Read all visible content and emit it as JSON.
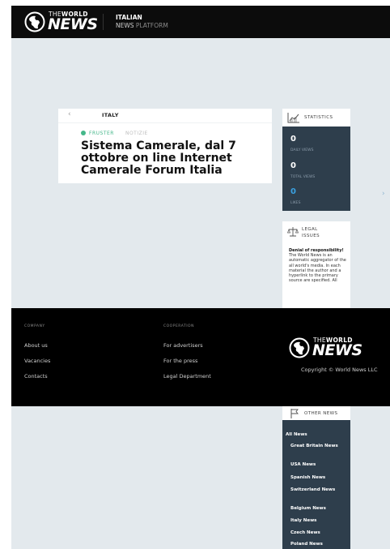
{
  "header": {
    "logo_the": "THE",
    "logo_world": "WORLD",
    "logo_news": "NEWS",
    "title_line1": "ITALIAN",
    "title_line2_a": "NEWS",
    "title_line2_b": "PLATFORM"
  },
  "article": {
    "back_label": "‹",
    "country": "ITALY",
    "tag_primary": "FRUSTER",
    "tag_secondary": "NOTIZIE",
    "headline": "Sistema Camerale, dal 7 ottobre on line Internet Camerale Forum Italia"
  },
  "statistics": {
    "title": "STATISTICS",
    "items": [
      {
        "value": "0",
        "label": "DAILY VIEWS"
      },
      {
        "value": "0",
        "label": "TOTAL VIEWS"
      },
      {
        "value": "0",
        "label": "LIKES"
      }
    ]
  },
  "legal": {
    "title_line1": "LEGAL",
    "title_line2": "ISSUES",
    "bold_text": "Denial of responsibility!",
    "text": " The World News is an automatic aggregator of the all world's media. In each material the author and a hyperlink to the primary source are specified. All"
  },
  "footer": {
    "col1_heading": "COMPANY",
    "col1_links": [
      "About us",
      "Vacancies",
      "Contacts"
    ],
    "col2_heading": "COOPERATION",
    "col2_links": [
      "For advertisers",
      "For the press",
      "Legal Department"
    ],
    "copyright": "Copyright © World News LLC"
  },
  "other_news": {
    "title": "OTHER NEWS",
    "links": [
      "All News",
      "Great Britain News",
      "USA News",
      "Spanish News",
      "Switzerland News",
      "Belgium News",
      "Italy News",
      "Czech News",
      "Poland News"
    ]
  },
  "colors": {
    "header_bg": "#0c0c0c",
    "page_bg": "#e3e9ed",
    "panel_dark": "#2e3e4c",
    "accent_green": "#45b78a",
    "stat_accent": "#3aa0e0"
  }
}
